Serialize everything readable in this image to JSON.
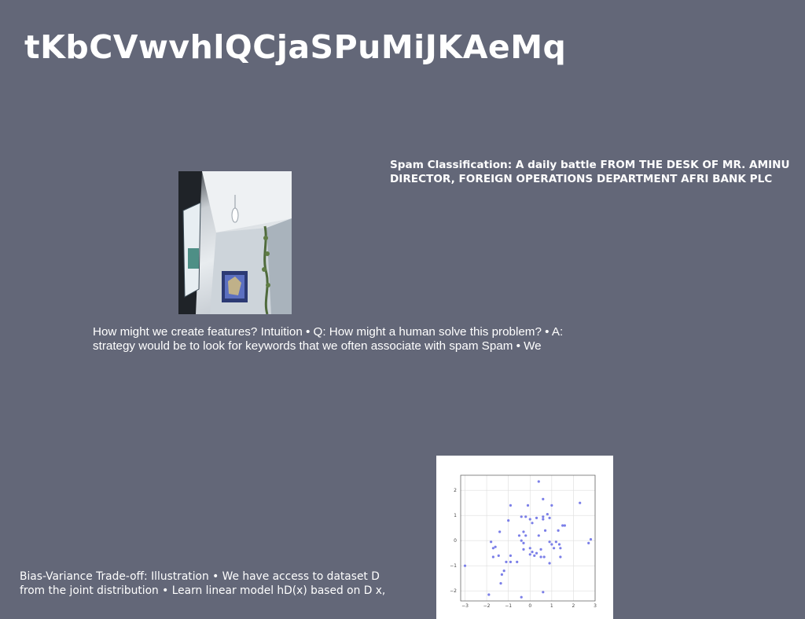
{
  "slide": {
    "title": "tKbCVwvhlQCjaSPuMiJKAeMq",
    "heading": "Spam Classification: A daily battle FROM THE DESK OF MR. AMINU DIRECTOR, FOREIGN OPERATIONS DEPARTMENT AFRI BANK PLC",
    "paragraph": "How might we create features? Intuition • Q: How might a human solve this problem? • A: strategy would be to look for keywords that we often associate with spam Spam • We",
    "caption": "Bias-Variance Trade-off: Illustration • We have access to dataset D from the joint distribution • Learn linear model hD(x) based on D x,"
  },
  "photo": {
    "icon": "room-photo-icon"
  },
  "chart_data": {
    "type": "scatter",
    "xlim": [
      -3.2,
      3.0
    ],
    "ylim": [
      -2.4,
      2.6
    ],
    "x_ticks": [
      "-3",
      "-2",
      "-1",
      "0",
      "1",
      "2",
      "3"
    ],
    "y_ticks": [
      "-2",
      "-1",
      "0",
      "1",
      "2"
    ],
    "grid": true,
    "point_color": "#7b7fe8",
    "points": [
      [
        0.4,
        2.35
      ],
      [
        0.6,
        1.65
      ],
      [
        2.3,
        1.5
      ],
      [
        -0.9,
        1.4
      ],
      [
        -0.1,
        1.4
      ],
      [
        1.0,
        1.4
      ],
      [
        -0.4,
        0.95
      ],
      [
        -0.2,
        0.95
      ],
      [
        0.0,
        0.85
      ],
      [
        0.3,
        0.9
      ],
      [
        0.6,
        0.95
      ],
      [
        0.6,
        0.85
      ],
      [
        0.8,
        1.05
      ],
      [
        0.9,
        0.9
      ],
      [
        -1.0,
        0.8
      ],
      [
        0.1,
        0.7
      ],
      [
        1.5,
        0.6
      ],
      [
        1.6,
        0.6
      ],
      [
        -1.4,
        0.35
      ],
      [
        -0.3,
        0.35
      ],
      [
        0.7,
        0.4
      ],
      [
        1.3,
        0.4
      ],
      [
        -0.2,
        0.2
      ],
      [
        -0.5,
        0.2
      ],
      [
        0.4,
        0.2
      ],
      [
        -1.8,
        -0.05
      ],
      [
        -0.4,
        0.0
      ],
      [
        -0.3,
        -0.1
      ],
      [
        0.9,
        -0.05
      ],
      [
        1.2,
        -0.05
      ],
      [
        2.8,
        0.05
      ],
      [
        2.7,
        -0.1
      ],
      [
        -1.6,
        -0.25
      ],
      [
        -1.7,
        -0.3
      ],
      [
        -0.3,
        -0.35
      ],
      [
        0.0,
        -0.3
      ],
      [
        0.1,
        -0.45
      ],
      [
        0.5,
        -0.35
      ],
      [
        1.1,
        -0.3
      ],
      [
        1.4,
        -0.3
      ],
      [
        1.0,
        -0.15
      ],
      [
        1.35,
        -0.15
      ],
      [
        -1.45,
        -0.6
      ],
      [
        -1.7,
        -0.65
      ],
      [
        -0.9,
        -0.6
      ],
      [
        0.0,
        -0.55
      ],
      [
        0.2,
        -0.6
      ],
      [
        0.3,
        -0.5
      ],
      [
        0.5,
        -0.65
      ],
      [
        0.65,
        -0.65
      ],
      [
        1.4,
        -0.65
      ],
      [
        -0.9,
        -0.85
      ],
      [
        -1.1,
        -0.85
      ],
      [
        -0.6,
        -0.85
      ],
      [
        0.9,
        -0.9
      ],
      [
        -3.0,
        -1.0
      ],
      [
        -1.2,
        -1.2
      ],
      [
        -1.3,
        -1.35
      ],
      [
        -1.35,
        -1.7
      ],
      [
        -1.9,
        -2.15
      ],
      [
        -0.4,
        -2.25
      ],
      [
        0.6,
        -2.05
      ]
    ]
  }
}
